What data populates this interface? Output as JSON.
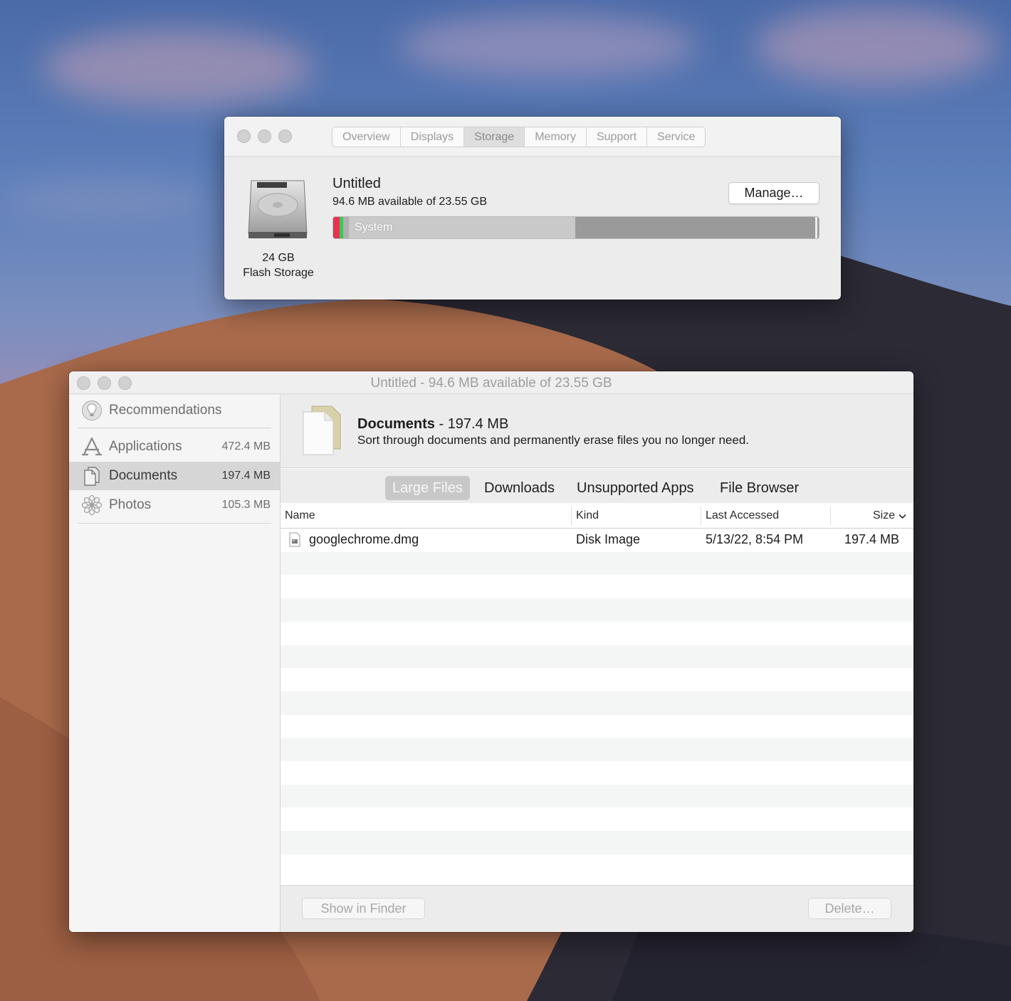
{
  "colors": {
    "storage_red": "#e8314f",
    "storage_green": "#44c15d",
    "storage_system": "#c9c9c9",
    "storage_other": "#9a9a9a",
    "active_tab": "#c8c8c8"
  },
  "about_window": {
    "tabs": [
      "Overview",
      "Displays",
      "Storage",
      "Memory",
      "Support",
      "Service"
    ],
    "active_tab": "Storage",
    "disk": {
      "size_line1": "24 GB",
      "size_line2": "Flash Storage",
      "volume_name": "Untitled",
      "available_text": "94.6 MB available of 23.55 GB",
      "manage_label": "Manage…",
      "bar": {
        "system_label": "System",
        "system_fraction": 0.48
      }
    }
  },
  "manager_window": {
    "title": "Untitled - 94.6 MB available of 23.55 GB",
    "sidebar": {
      "recommendations": {
        "label": "Recommendations",
        "icon": "lightbulb-icon"
      },
      "items": [
        {
          "label": "Applications",
          "size": "472.4 MB",
          "icon": "app-store-icon"
        },
        {
          "label": "Documents",
          "size": "197.4 MB",
          "icon": "documents-icon"
        },
        {
          "label": "Photos",
          "size": "105.3 MB",
          "icon": "photos-icon"
        }
      ],
      "active_item": "Documents"
    },
    "category": {
      "name": "Documents",
      "separator": " - ",
      "size": "197.4 MB",
      "description": "Sort through documents and permanently erase files you no longer need."
    },
    "tabs": [
      "Large Files",
      "Downloads",
      "Unsupported Apps",
      "File Browser"
    ],
    "active_tab": "Large Files",
    "table": {
      "columns": {
        "name": "Name",
        "kind": "Kind",
        "last_accessed": "Last Accessed",
        "size": "Size"
      },
      "rows": [
        {
          "name": "googlechrome.dmg",
          "kind": "Disk Image",
          "last_accessed": "5/13/22, 8:54 PM",
          "size": "197.4 MB"
        }
      ]
    },
    "footer": {
      "show_in_finder": "Show in Finder",
      "delete": "Delete…"
    }
  }
}
